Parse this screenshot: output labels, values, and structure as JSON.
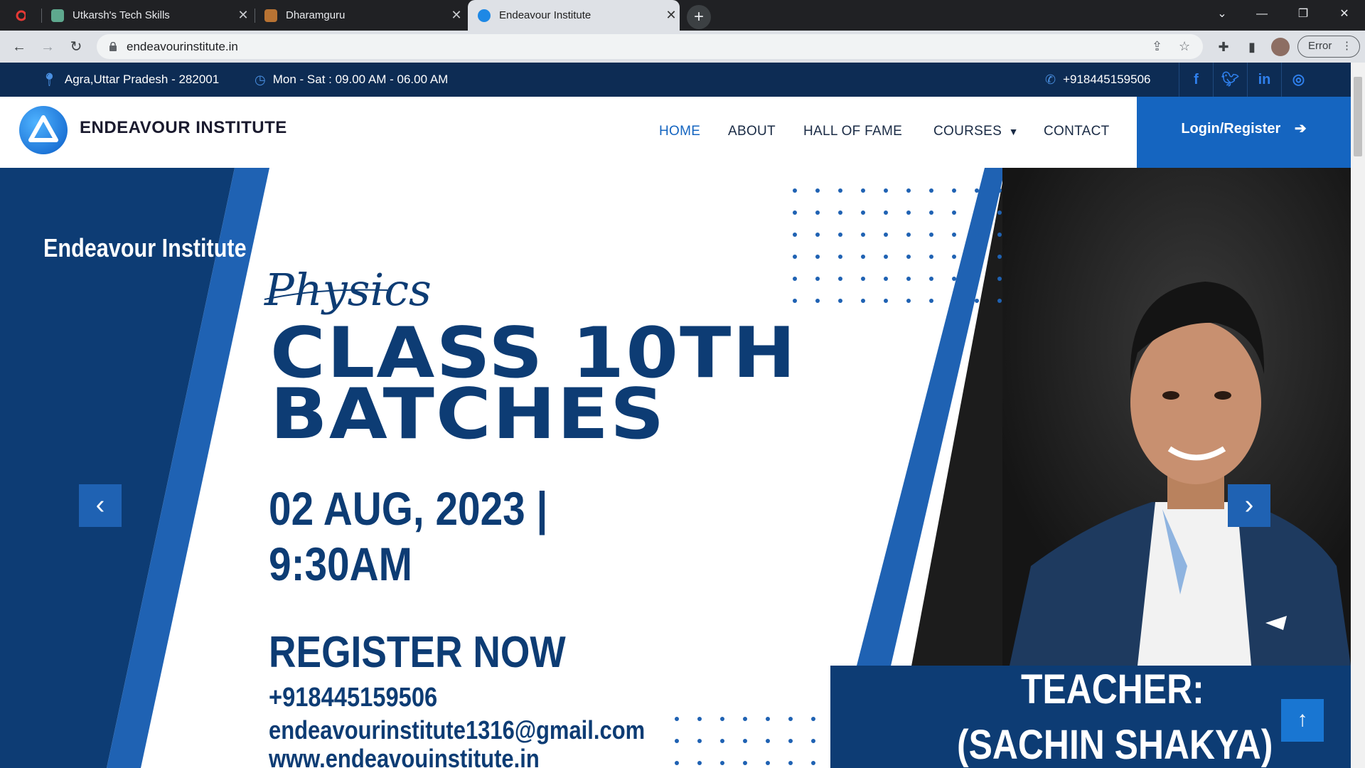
{
  "browser": {
    "tabs": [
      {
        "title": "Utkarsh's Tech Skills"
      },
      {
        "title": "Dharamguru"
      },
      {
        "title": "Endeavour Institute"
      }
    ],
    "url": "endeavourinstitute.in",
    "error_label": "Error"
  },
  "topbar": {
    "address": "Agra,Uttar Pradesh - 282001",
    "hours": "Mon - Sat : 09.00 AM - 06.00 AM",
    "phone": "+918445159506"
  },
  "header": {
    "brand": "ENDEAVOUR INSTITUTE",
    "nav": [
      "HOME",
      "ABOUT",
      "HALL OF FAME",
      "COURSES",
      "CONTACT"
    ],
    "login_label": "Login/Register"
  },
  "hero": {
    "institute": "Endeavour Institute",
    "subject": "Physics",
    "title_line1": "CLASS 10TH",
    "title_line2": "BATCHES",
    "date_line1": "02 AUG, 2023 |",
    "date_line2": "9:30AM",
    "register": "REGISTER NOW",
    "phone": "+918445159506",
    "email": "endeavourinstitute1316@gmail.com",
    "website": "www.endeavouinstitute.in",
    "teacher_label": "TEACHER:",
    "teacher_name": "(SACHIN SHAKYA)"
  },
  "colors": {
    "navy": "#0d2c54",
    "brand_blue": "#1565c0",
    "hero_navy": "#0d3c74"
  }
}
